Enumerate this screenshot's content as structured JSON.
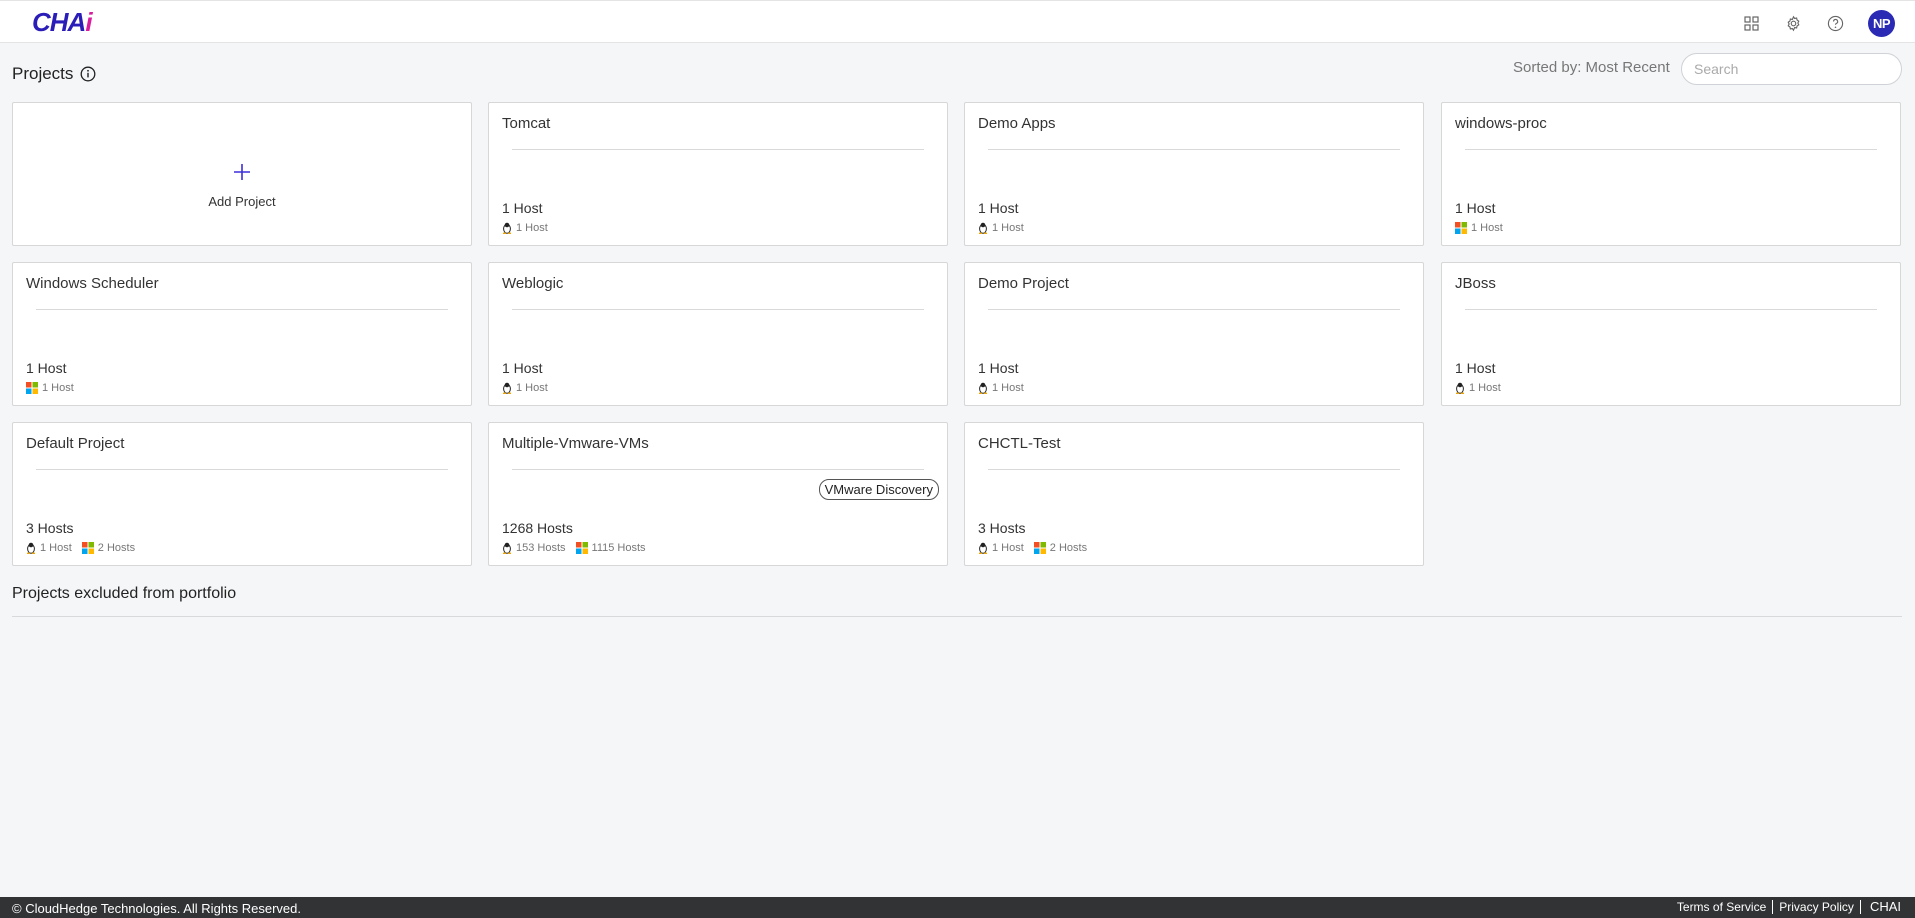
{
  "header": {
    "logo_main": "CHA",
    "logo_accent": "i",
    "avatar_initials": "NP"
  },
  "toolbar": {
    "title": "Projects",
    "sorted_label": "Sorted by: Most Recent",
    "search_placeholder": "Search"
  },
  "add_project": {
    "label": "Add Project"
  },
  "projects": [
    {
      "name": "Tomcat",
      "hosts": "1 Host",
      "linux": "1 Host"
    },
    {
      "name": "Demo Apps",
      "hosts": "1 Host",
      "linux": "1 Host"
    },
    {
      "name": "windows-proc",
      "hosts": "1 Host",
      "windows": "1 Host"
    },
    {
      "name": "Windows Scheduler",
      "hosts": "1 Host",
      "windows": "1 Host"
    },
    {
      "name": "Weblogic",
      "hosts": "1 Host",
      "linux": "1 Host"
    },
    {
      "name": "Demo Project",
      "hosts": "1 Host",
      "linux": "1 Host"
    },
    {
      "name": "JBoss",
      "hosts": "1 Host",
      "linux": "1 Host"
    },
    {
      "name": "Default Project",
      "hosts": "3 Hosts",
      "linux": "1 Host",
      "windows": "2 Hosts"
    },
    {
      "name": "Multiple-Vmware-VMs",
      "hosts": "1268 Hosts",
      "linux": "153 Hosts",
      "windows": "1115 Hosts",
      "badge": "VMware Discovery"
    },
    {
      "name": "CHCTL-Test",
      "hosts": "3 Hosts",
      "linux": "1 Host",
      "windows": "2 Hosts"
    }
  ],
  "excluded": {
    "title": "Projects excluded from portfolio"
  },
  "footer": {
    "copyright": "© CloudHedge Technologies. All Rights Reserved.",
    "terms": "Terms of Service",
    "privacy": "Privacy Policy",
    "brand": "CHAI"
  },
  "colors": {
    "accent": "#2a2ab5",
    "logo_accent": "#d81e9e",
    "footer_bg": "#323335"
  },
  "icons": {
    "apps": "grid-icon",
    "settings": "gear-icon",
    "help": "help-icon",
    "linux": "linux-icon",
    "windows": "windows-icon"
  }
}
